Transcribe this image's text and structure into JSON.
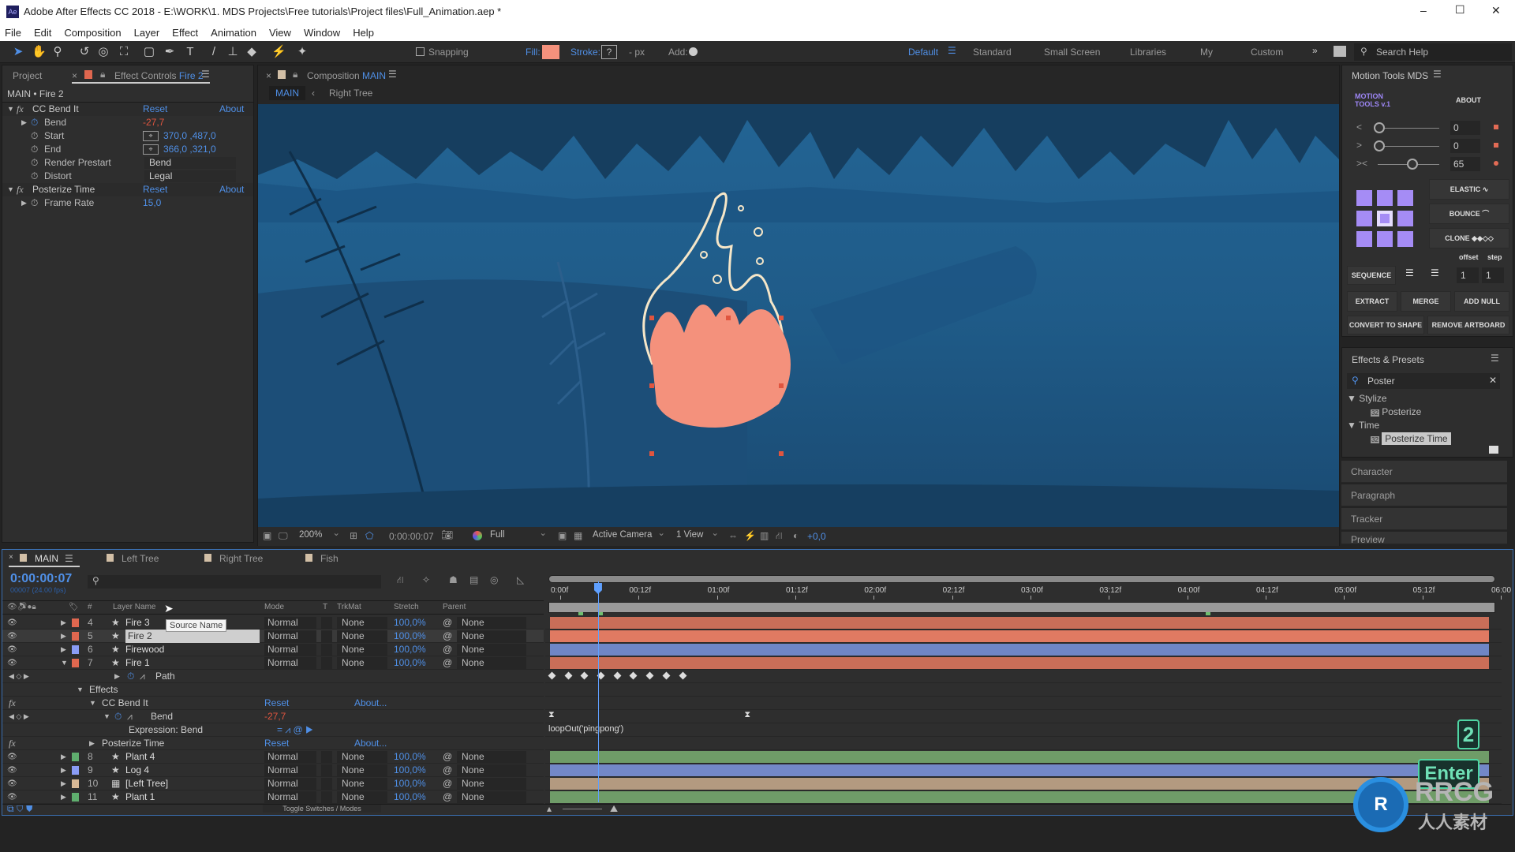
{
  "window": {
    "title": "Adobe After Effects CC 2018 - E:\\WORK\\1. MDS Projects\\Free tutorials\\Project files\\Full_Animation.aep *",
    "app_icon": "Ae",
    "controls": [
      "–",
      "☐",
      "✕"
    ]
  },
  "menu": [
    "File",
    "Edit",
    "Composition",
    "Layer",
    "Effect",
    "Animation",
    "View",
    "Window",
    "Help"
  ],
  "toolbar": {
    "snapping": "Snapping",
    "fill_label": "Fill:",
    "fill_color": "#f4917c",
    "stroke_label": "Stroke:",
    "stroke_value": "?",
    "px": "- px",
    "add_label": "Add:",
    "workspaces": [
      "Default",
      "Standard",
      "Small Screen",
      "Libraries",
      "My",
      "Custom"
    ],
    "active_workspace": "Default",
    "search_placeholder": "Search Help"
  },
  "left_panel": {
    "tab_project": "Project",
    "tab_effect_controls": "Effect Controls",
    "layer": "Fire 2",
    "breadcrumb": "MAIN • Fire 2",
    "effects": [
      {
        "name": "CC Bend It",
        "reset": "Reset",
        "about": "About",
        "props": [
          {
            "name": "Bend",
            "value": "-27,7",
            "color": "red"
          },
          {
            "name": "Start",
            "value": "370,0 ,487,0",
            "color": "blue",
            "target": true
          },
          {
            "name": "End",
            "value": "366,0 ,321,0",
            "color": "blue",
            "target": true
          },
          {
            "name": "Render Prestart",
            "value": "Bend",
            "dropdown": true
          },
          {
            "name": "Distort",
            "value": "Legal",
            "dropdown": true
          }
        ]
      },
      {
        "name": "Posterize Time",
        "reset": "Reset",
        "about": "About",
        "props": [
          {
            "name": "Frame Rate",
            "value": "15,0",
            "color": "blue"
          }
        ]
      }
    ]
  },
  "composition": {
    "tab_label": "Composition",
    "comp_name": "MAIN",
    "breadcrumb": [
      "MAIN",
      "Right Tree"
    ],
    "viewer": {
      "zoom": "200%",
      "timecode": "0:00:00:07",
      "resolution": "Full",
      "camera": "Active Camera",
      "views": "1 View",
      "exposure": "+0,0"
    }
  },
  "motion_tools": {
    "title": "Motion Tools MDS",
    "logo": "MOTION TOOLS v.1",
    "about": "ABOUT",
    "sliders": [
      {
        "icon": "<",
        "value": "0",
        "level": 0
      },
      {
        "icon": ">",
        "value": "0",
        "level": 0
      },
      {
        "icon": "><",
        "value": "65",
        "level": 0.65
      }
    ],
    "buttons": {
      "elastic": "ELASTIC",
      "bounce": "BOUNCE",
      "clone": "CLONE",
      "offset": "offset",
      "step": "step",
      "sequence": "SEQUENCE",
      "offset_value": "1",
      "step_value": "1",
      "extract": "EXTRACT",
      "merge": "MERGE",
      "add_null": "ADD NULL",
      "convert": "CONVERT TO SHAPE",
      "remove_artboard": "REMOVE ARTBOARD"
    }
  },
  "effects_presets": {
    "title": "Effects & Presets",
    "search": "Poster",
    "tree": [
      {
        "category": "Stylize",
        "items": [
          "Posterize"
        ]
      },
      {
        "category": "Time",
        "items": [
          "Posterize Time"
        ]
      }
    ],
    "selected": "Posterize Time",
    "collapsed_panels": [
      "Character",
      "Paragraph",
      "Tracker",
      "Preview"
    ]
  },
  "timeline": {
    "tabs": [
      "MAIN",
      "Left Tree",
      "Right Tree",
      "Fish"
    ],
    "active_tab": "MAIN",
    "timecode": "0:00:00:07",
    "frame_info": "00007 (24.00 fps)",
    "columns": {
      "num": "#",
      "layer_name": "Layer Name",
      "mode": "Mode",
      "t": "T",
      "trkmat": "TrkMat",
      "stretch": "Stretch",
      "parent": "Parent"
    },
    "tooltip": "Source Name",
    "footer": "Toggle Switches / Modes",
    "ruler": [
      "0:00f",
      "00:12f",
      "01:00f",
      "01:12f",
      "02:00f",
      "02:12f",
      "03:00f",
      "03:12f",
      "04:00f",
      "04:12f",
      "05:00f",
      "05:12f",
      "06:00"
    ],
    "current_frame": 7,
    "frames_total": 144,
    "rows": [
      {
        "type": "layer",
        "num": "4",
        "name": "Fire 3",
        "color": "#e0674f",
        "mode": "Normal",
        "trkmat": "None",
        "stretch": "100,0%",
        "parent": "None",
        "bar": "#c96e58"
      },
      {
        "type": "layer",
        "num": "5",
        "name": "Fire 2",
        "color": "#e0674f",
        "mode": "Normal",
        "trkmat": "None",
        "stretch": "100,0%",
        "parent": "None",
        "bar": "#e07a62",
        "selected": true
      },
      {
        "type": "layer",
        "num": "6",
        "name": "Firewood",
        "color": "#8a9cf5",
        "mode": "Normal",
        "trkmat": "None",
        "stretch": "100,0%",
        "parent": "None",
        "bar": "#6f86c6"
      },
      {
        "type": "layer",
        "num": "7",
        "name": "Fire 1",
        "color": "#e0674f",
        "mode": "Normal",
        "trkmat": "None",
        "stretch": "100,0%",
        "parent": "None",
        "bar": "#c96e58",
        "expanded": true
      },
      {
        "type": "prop",
        "name": "Path",
        "indent": 1,
        "keyframes": [
          0,
          2.5,
          5,
          7.5,
          10,
          12.5,
          15,
          17.5,
          20
        ]
      },
      {
        "type": "group",
        "name": "Effects",
        "indent": 0
      },
      {
        "type": "effect",
        "name": "CC Bend It",
        "reset": "Reset",
        "about": "About..."
      },
      {
        "type": "prop",
        "name": "Bend",
        "indent": 2,
        "value": "-27,7",
        "expr_keys": [
          0,
          30
        ]
      },
      {
        "type": "expr",
        "name": "Expression: Bend",
        "expression": "loopOut('pingpong')"
      },
      {
        "type": "effect",
        "name": "Posterize Time",
        "reset": "Reset",
        "about": "About...",
        "collapsed": true
      },
      {
        "type": "layer",
        "num": "8",
        "name": "Plant 4",
        "color": "#5fae6e",
        "mode": "Normal",
        "trkmat": "None",
        "stretch": "100,0%",
        "parent": "None",
        "bar": "#6f9c68"
      },
      {
        "type": "layer",
        "num": "9",
        "name": "Log 4",
        "color": "#8a9cf5",
        "mode": "Normal",
        "trkmat": "None",
        "stretch": "100,0%",
        "parent": "None",
        "bar": "#7388c8"
      },
      {
        "type": "layer",
        "num": "10",
        "name": "[Left Tree]",
        "color": "#d8b896",
        "mode": "Normal",
        "trkmat": "None",
        "stretch": "100,0%",
        "parent": "None",
        "bar": "#b39a80",
        "comp": true
      },
      {
        "type": "layer",
        "num": "11",
        "name": "Plant 1",
        "color": "#5fae6e",
        "mode": "Normal",
        "trkmat": "None",
        "stretch": "100,0%",
        "parent": "None",
        "bar": "#6f9c68"
      }
    ]
  },
  "overlay": {
    "key1": "2",
    "key2": "Enter",
    "watermark": "RRCG",
    "watermark_sub": "人人素材"
  }
}
